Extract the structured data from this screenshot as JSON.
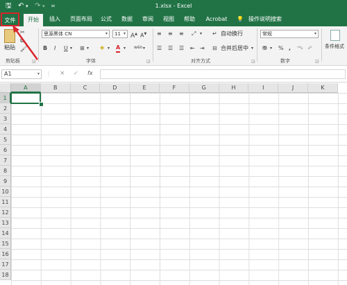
{
  "titlebar": {
    "title": "1.xlsx  -  Excel",
    "save_icon": "save-icon",
    "undo_icon": "undo-icon",
    "redo_icon": "redo-icon"
  },
  "tabs": [
    {
      "label": "文件"
    },
    {
      "label": "开始"
    },
    {
      "label": "插入"
    },
    {
      "label": "页面布局"
    },
    {
      "label": "公式"
    },
    {
      "label": "数据"
    },
    {
      "label": "审阅"
    },
    {
      "label": "视图"
    },
    {
      "label": "帮助"
    },
    {
      "label": "Acrobat"
    },
    {
      "label": "操作说明搜索"
    }
  ],
  "ribbon": {
    "clipboard": {
      "paste": "粘贴",
      "label": "剪贴板"
    },
    "font": {
      "name": "思源黑体 CN",
      "size": "11",
      "label": "字体",
      "bold": "B",
      "italic": "I",
      "underline": "U"
    },
    "alignment": {
      "wrap": "自动换行",
      "merge": "合并后居中",
      "label": "对齐方式"
    },
    "number": {
      "format": "常规",
      "label": "数字"
    },
    "styles": {
      "conditional": "条件格式"
    }
  },
  "formula_bar": {
    "name_box": "A1",
    "cancel": "×",
    "enter": "✓",
    "fx": "fx"
  },
  "sheet": {
    "columns": [
      "A",
      "B",
      "C",
      "D",
      "E",
      "F",
      "G",
      "H",
      "I",
      "J",
      "K"
    ],
    "rows": [
      "1",
      "2",
      "3",
      "4",
      "5",
      "6",
      "7",
      "8",
      "9",
      "10",
      "11",
      "12",
      "13",
      "14",
      "15",
      "16",
      "17",
      "18"
    ]
  },
  "colors": {
    "accent": "#217346",
    "annotation": "#d9242b"
  }
}
